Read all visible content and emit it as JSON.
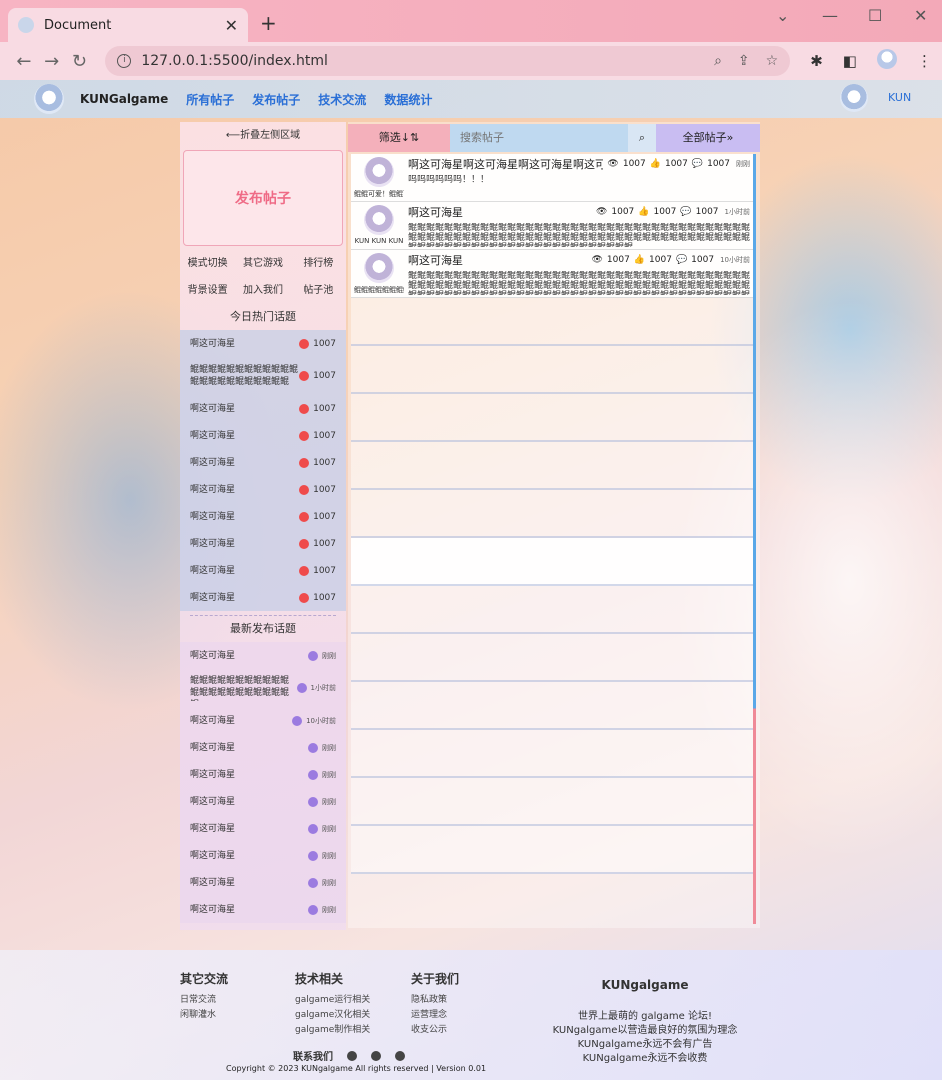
{
  "browser": {
    "tab_title": "Document",
    "url": "127.0.0.1:5500/index.html"
  },
  "header": {
    "brand": "KUNGalgame",
    "nav": [
      "所有帖子",
      "发布帖子",
      "技术交流",
      "数据统计"
    ],
    "user": "KUN"
  },
  "sidebar": {
    "collapse": "⟵折叠左侧区域",
    "publish": "发布帖子",
    "menu": [
      "模式切换",
      "其它游戏",
      "排行榜",
      "背景设置",
      "加入我们",
      "帖子池"
    ],
    "hot_title": "今日热门话题",
    "hot": [
      {
        "title": "啊这可海星",
        "count": "1007"
      },
      {
        "title": "鲲鲲鲲鲲鲲鲲鲲鲲鲲鲲鲲鲲鲲鲲鲲鲲鲲鲲鲲鲲鲲鲲鲲",
        "count": "1007"
      },
      {
        "title": "啊这可海星",
        "count": "1007"
      },
      {
        "title": "啊这可海星",
        "count": "1007"
      },
      {
        "title": "啊这可海星",
        "count": "1007"
      },
      {
        "title": "啊这可海星",
        "count": "1007"
      },
      {
        "title": "啊这可海星",
        "count": "1007"
      },
      {
        "title": "啊这可海星",
        "count": "1007"
      },
      {
        "title": "啊这可海星",
        "count": "1007"
      },
      {
        "title": "啊这可海星",
        "count": "1007"
      }
    ],
    "new_title": "最新发布话题",
    "new": [
      {
        "title": "啊这可海星",
        "time": "刚刚"
      },
      {
        "title": "鲲鲲鲲鲲鲲鲲鲲鲲鲲鲲鲲鲲鲲鲲鲲鲲鲲鲲鲲鲲鲲鲲鲲",
        "time": "1小时前"
      },
      {
        "title": "啊这可海星",
        "time": "10小时前"
      },
      {
        "title": "啊这可海星",
        "time": "刚刚"
      },
      {
        "title": "啊这可海星",
        "time": "刚刚"
      },
      {
        "title": "啊这可海星",
        "time": "刚刚"
      },
      {
        "title": "啊这可海星",
        "time": "刚刚"
      },
      {
        "title": "啊这可海星",
        "time": "刚刚"
      },
      {
        "title": "啊这可海星",
        "time": "刚刚"
      },
      {
        "title": "啊这可海星",
        "time": "刚刚"
      }
    ]
  },
  "toolbar": {
    "filter": "筛选↓⇅",
    "search_placeholder": "搜索帖子",
    "all": "全部帖子»"
  },
  "posts": [
    {
      "author": "鲲鲲可爱！鲲鲲可爱！",
      "title": "啊这可海星啊这可海星啊这可海星啊这可海星啊这可海星",
      "views": "1007",
      "likes": "1007",
      "comments": "1007",
      "time": "刚刚",
      "content": "呜呜呜呜呜呜！！！"
    },
    {
      "author": "KUN KUN KUN",
      "title": "啊这可海星",
      "views": "1007",
      "likes": "1007",
      "comments": "1007",
      "time": "1小时前",
      "content": "鲲鲲鲲鲲鲲鲲鲲鲲鲲鲲鲲鲲鲲鲲鲲鲲鲲鲲鲲鲲鲲鲲鲲鲲鲲鲲鲲鲲鲲鲲鲲鲲鲲鲲鲲鲲鲲鲲鲲鲲鲲鲲鲲鲲鲲鲲鲲鲲鲲鲲鲲鲲鲲鲲鲲鲲鲲鲲鲲鲲鲲鲲鲲鲲鲲鲲鲲鲲鲲鲲鲲鲲鲲鲲鲲鲲鲲鲲鲲鲲鲲鲲鲲鲲鲲鲲鲲鲲鲲鲲鲲鲲鲲鲲鲲鲲鲲鲲鲲鲲鲲"
    },
    {
      "author": "鲲鲲鲲鲲鲲鲲鲲鲲",
      "title": "啊这可海星",
      "views": "1007",
      "likes": "1007",
      "comments": "1007",
      "time": "10小时前",
      "content": "鲲鲲鲲鲲鲲鲲鲲鲲鲲鲲鲲鲲鲲鲲鲲鲲鲲鲲鲲鲲鲲鲲鲲鲲鲲鲲鲲鲲鲲鲲鲲鲲鲲鲲鲲鲲鲲鲲鲲鲲鲲鲲鲲鲲鲲鲲鲲鲲鲲鲲鲲鲲鲲鲲鲲鲲鲲鲲鲲鲲鲲鲲鲲鲲鲲鲲鲲鲲鲲鲲鲲鲲鲲鲲鲲鲲鲲鲲鲲鲲鲲鲲鲲鲲鲲鲲鲲鲲鲲鲲鲲鲲鲲鲲鲲鲲鲲鲲鲲鲲鲲鲲鲲鲲鲲鲲鲲鲲鲲鲲鲲鲲鲲鲲鲲鲲"
    }
  ],
  "footer": {
    "col1": {
      "title": "其它交流",
      "items": [
        "日常交流",
        "闲聊灌水"
      ]
    },
    "col2": {
      "title": "技术相关",
      "items": [
        "galgame运行相关",
        "galgame汉化相关",
        "galgame制作相关"
      ]
    },
    "col3": {
      "title": "关于我们",
      "items": [
        "隐私政策",
        "运营理念",
        "收支公示"
      ]
    },
    "brand": {
      "title": "KUNgalgame",
      "lines": [
        "世界上最萌的 galgame 论坛!",
        "KUNgalgame以营造最良好的氛围为理念",
        "KUNgalgame永远不会有广告",
        "KUNgalgame永远不会收费"
      ]
    },
    "contact": "联系我们",
    "copyright": "Copyright © 2023 KUNgalgame All rights reserved | Version 0.01"
  }
}
